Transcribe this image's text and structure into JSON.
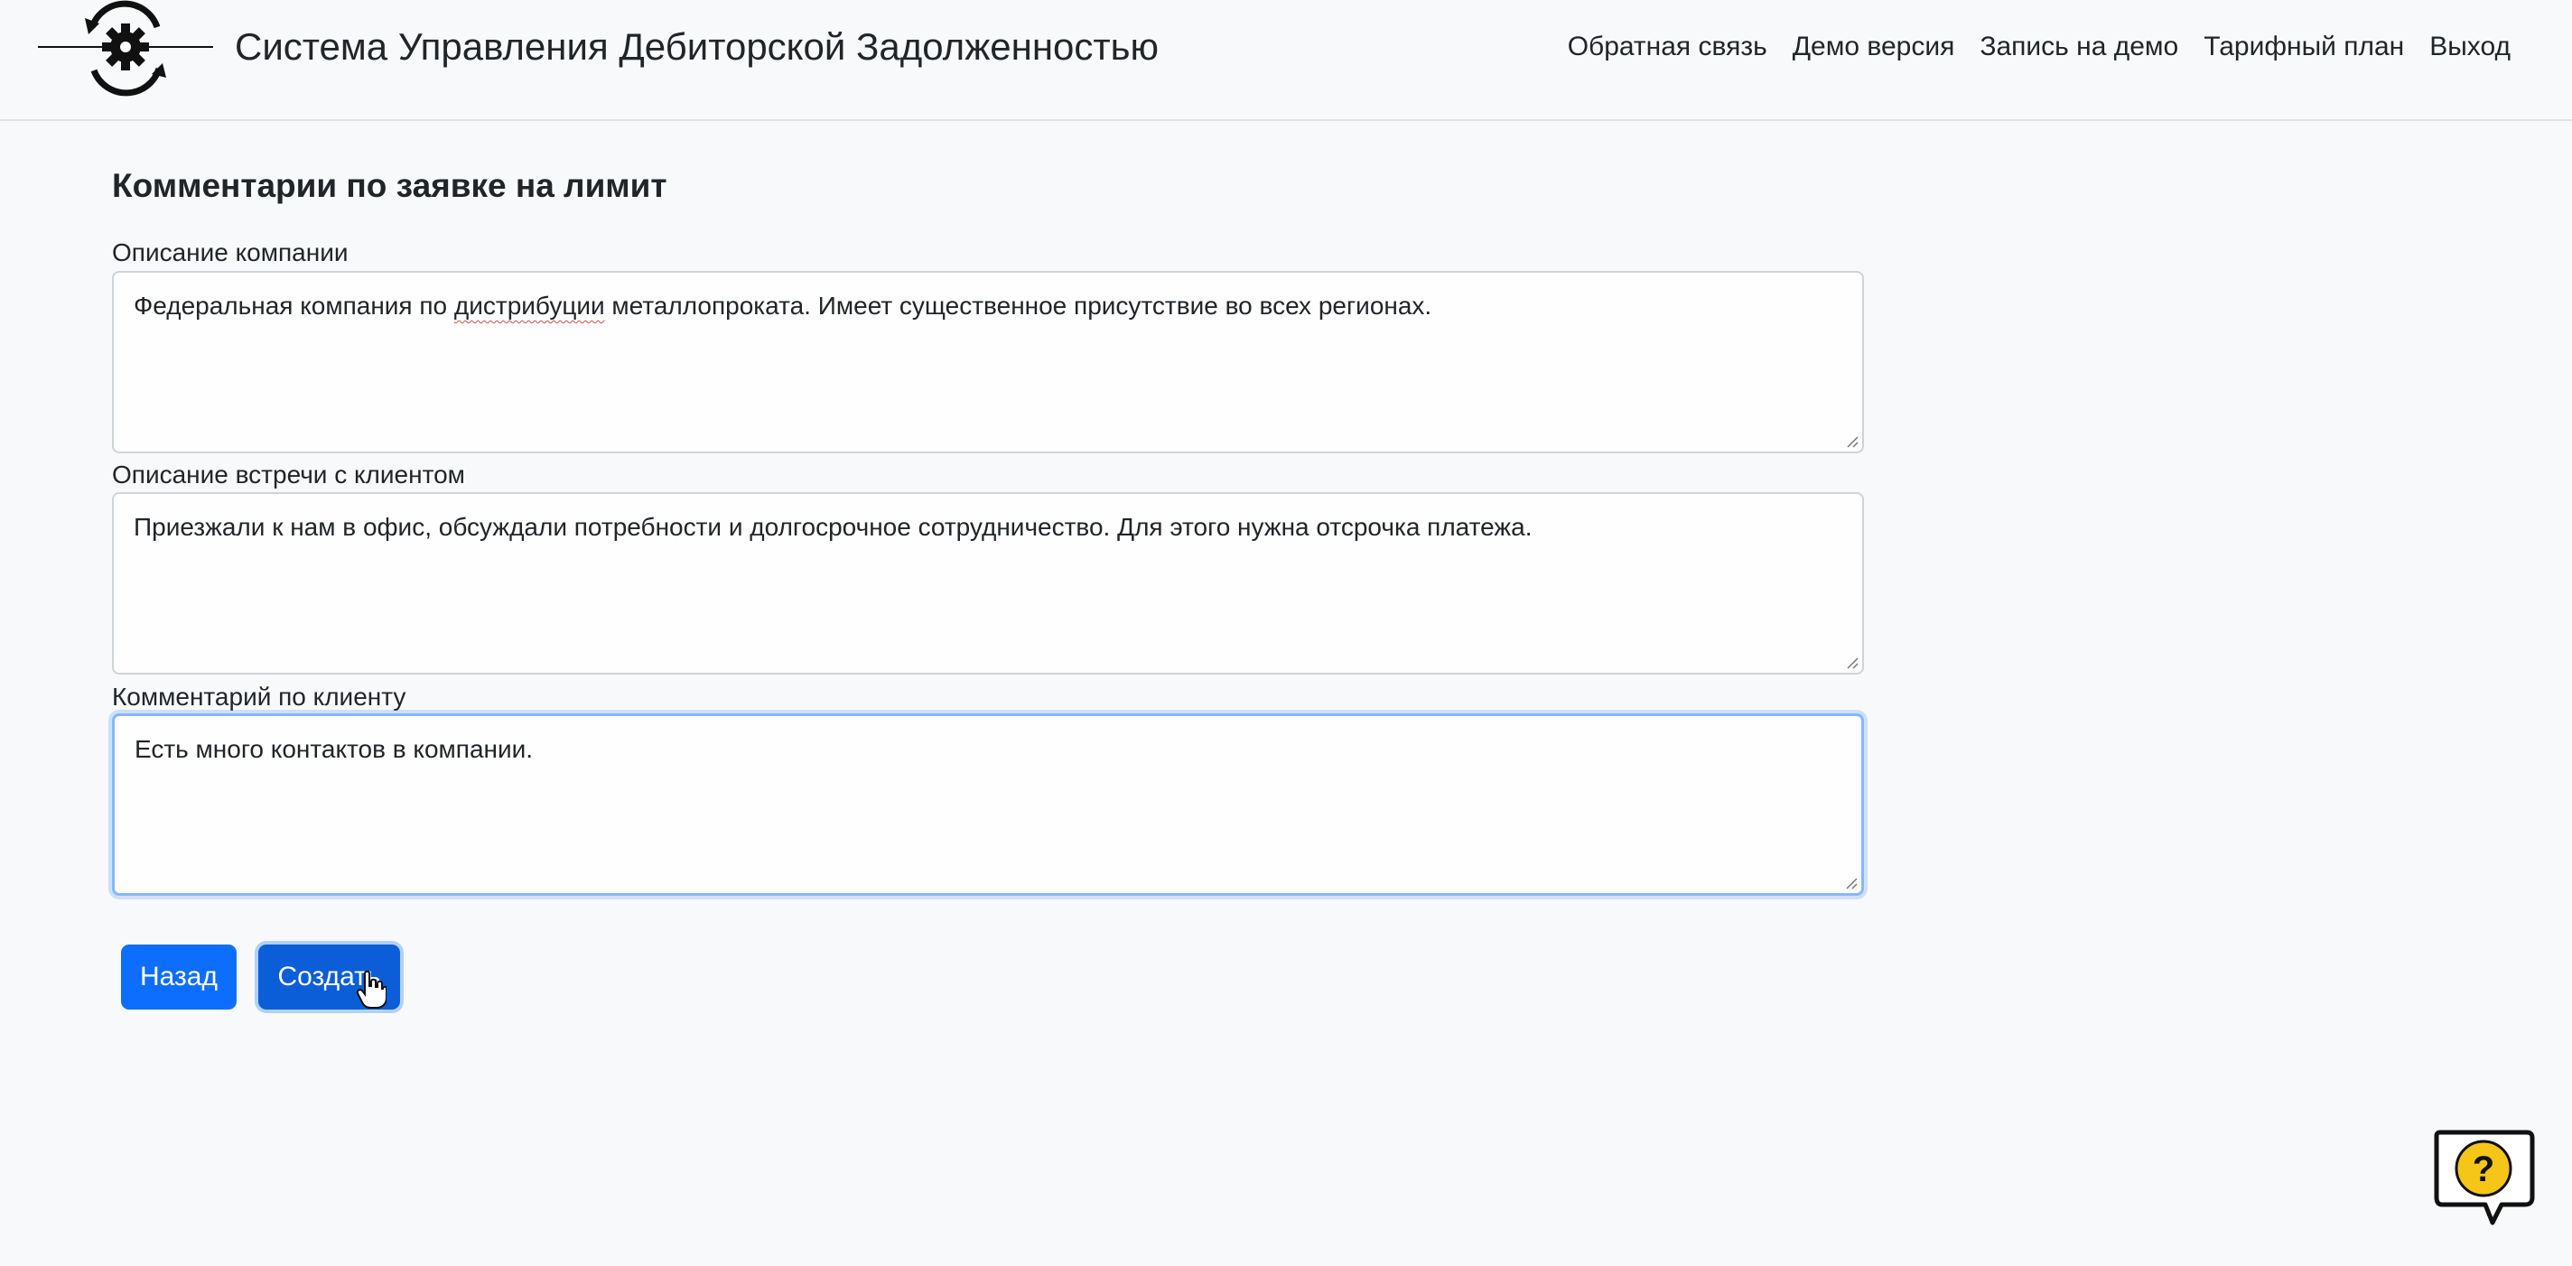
{
  "header": {
    "title": "Система Управления Дебиторской Задолженностью",
    "logo_icon": "gear-cycle-logo",
    "nav": [
      {
        "label": "Обратная связь"
      },
      {
        "label": "Демо версия"
      },
      {
        "label": "Запись на демо"
      },
      {
        "label": "Тарифный план"
      },
      {
        "label": "Выход"
      }
    ]
  },
  "form": {
    "title": "Комментарии по заявке на лимит",
    "company_description": {
      "label": "Описание компании",
      "value_before": "Федеральная компания по ",
      "value_flagged": "дистрибуции",
      "value_after": " металлопроката. Имеет существенное присутствие во всех регионах."
    },
    "meeting_description": {
      "label": "Описание встречи с клиентом",
      "value": "Приезжали к нам в офис, обсуждали потребности и долгосрочное сотрудничество. Для этого нужна отсрочка платежа."
    },
    "client_comment": {
      "label": "Комментарий по клиенту",
      "value": "Есть много контактов в компании."
    },
    "buttons": {
      "back": "Назад",
      "create": "Создать"
    }
  },
  "help_widget": {
    "icon": "question-chat-icon",
    "symbol": "?"
  },
  "colors": {
    "primary": "#0d6efd",
    "primary_active": "#0b5ed7",
    "help_yellow": "#f5c518",
    "background": "#f8f9fb"
  }
}
